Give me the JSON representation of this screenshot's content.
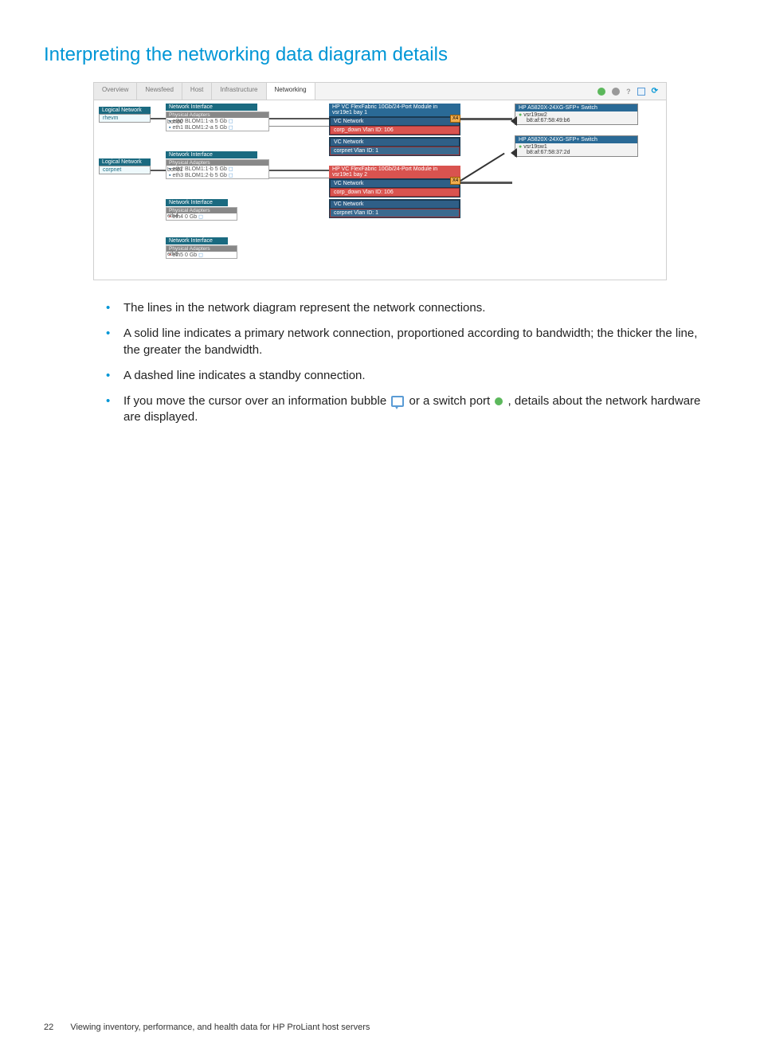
{
  "title": "Interpreting the networking data diagram details",
  "tabs": [
    "Overview",
    "Newsfeed",
    "Host",
    "Infrastructure",
    "Networking"
  ],
  "activeTab": 4,
  "diagram": {
    "logicalNetworks": [
      "rhevm",
      "corpnet"
    ],
    "niLabel": "Network Interface",
    "paLabel": "Physical Adapters",
    "bonds": [
      {
        "name": "bond0",
        "adapters": [
          "eth0 BLOM1:1-a 5 Gb",
          "eth1 BLOM1:2-a 5 Gb"
        ]
      },
      {
        "name": "bond1",
        "adapters": [
          "eth2 BLOM1:1-b 5 Gb",
          "eth3 BLOM1:2-b 5 Gb"
        ]
      }
    ],
    "looseIfs": [
      {
        "name": "eth4",
        "adapter": "eth4 0 Gb"
      },
      {
        "name": "eth5",
        "adapter": "eth5 0 Gb"
      }
    ],
    "modules": [
      {
        "title": "HP VC FlexFabric 10Gb/24-Port Module in vsr19e1 bay 1",
        "nets": [
          {
            "type": "VC Network",
            "detail": "corp_down Vlan ID: 106"
          },
          {
            "type": "VC Network",
            "detail": "corpnet Vlan ID: 1"
          }
        ],
        "port": "X4"
      },
      {
        "title": "HP VC FlexFabric 10Gb/24-Port Module in vsr19e1 bay 2",
        "nets": [
          {
            "type": "VC Network",
            "detail": "corp_down Vlan ID: 106"
          },
          {
            "type": "VC Network",
            "detail": "corpnet Vlan ID: 1"
          }
        ],
        "port": "X4"
      }
    ],
    "switches": [
      {
        "model": "HP A5820X-24XG-SFP+ Switch",
        "name": "vsr19sw2",
        "mac": "b8:af:67:58:49:b6"
      },
      {
        "model": "HP A5820X-24XG-SFP+ Switch",
        "name": "vsr19sw1",
        "mac": "b8:af:67:58:37:2d"
      }
    ]
  },
  "bullets": [
    "The lines in the network diagram represent the network connections.",
    "A solid line indicates a primary network connection, proportioned according to bandwidth; the thicker the line, the greater the bandwidth.",
    "A dashed line indicates a standby connection.",
    "If you move the cursor over an information bubble {BUBBLE} or a switch port {PORT} , details about the network hardware are displayed."
  ],
  "footer": {
    "page": "22",
    "text": "Viewing inventory, performance, and health data for HP ProLiant host servers"
  }
}
